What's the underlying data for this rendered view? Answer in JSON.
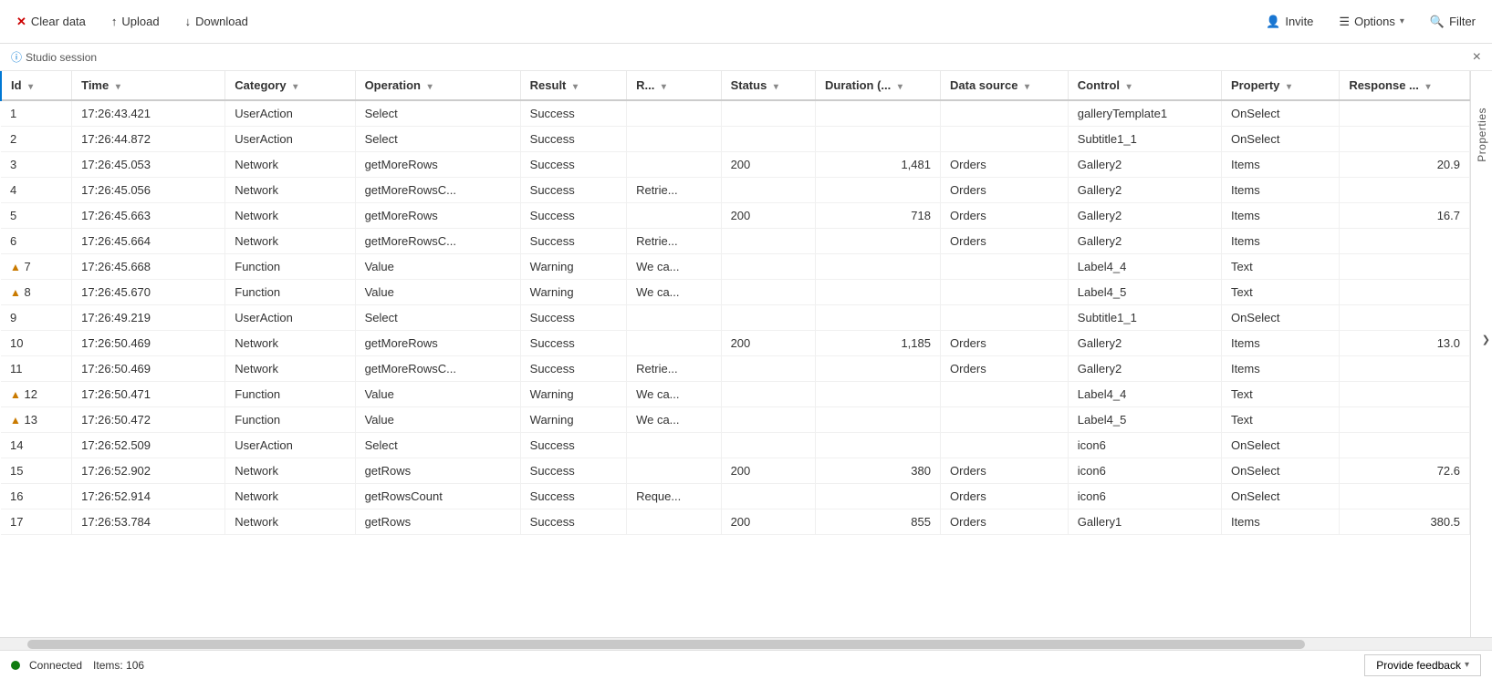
{
  "toolbar": {
    "clear_label": "Clear data",
    "upload_label": "Upload",
    "download_label": "Download",
    "invite_label": "Invite",
    "options_label": "Options",
    "filter_label": "Filter"
  },
  "session": {
    "label": "Studio session",
    "close_label": "×"
  },
  "side_panel": {
    "label": "Properties",
    "chevron": "❯"
  },
  "table": {
    "columns": [
      {
        "key": "id",
        "label": "Id",
        "sortable": true
      },
      {
        "key": "time",
        "label": "Time",
        "sortable": true
      },
      {
        "key": "category",
        "label": "Category",
        "sortable": true
      },
      {
        "key": "operation",
        "label": "Operation",
        "sortable": true
      },
      {
        "key": "result",
        "label": "Result",
        "sortable": true
      },
      {
        "key": "r",
        "label": "R...",
        "sortable": true
      },
      {
        "key": "status",
        "label": "Status",
        "sortable": true
      },
      {
        "key": "duration",
        "label": "Duration (...",
        "sortable": true
      },
      {
        "key": "datasource",
        "label": "Data source",
        "sortable": true
      },
      {
        "key": "control",
        "label": "Control",
        "sortable": true
      },
      {
        "key": "property",
        "label": "Property",
        "sortable": true
      },
      {
        "key": "response",
        "label": "Response ...",
        "sortable": true
      }
    ],
    "rows": [
      {
        "id": 1,
        "warning": false,
        "time": "17:26:43.421",
        "category": "UserAction",
        "operation": "Select",
        "result": "Success",
        "r": "",
        "status": "",
        "duration": "",
        "datasource": "",
        "control": "galleryTemplate1",
        "property": "OnSelect",
        "response": ""
      },
      {
        "id": 2,
        "warning": false,
        "time": "17:26:44.872",
        "category": "UserAction",
        "operation": "Select",
        "result": "Success",
        "r": "",
        "status": "",
        "duration": "",
        "datasource": "",
        "control": "Subtitle1_1",
        "property": "OnSelect",
        "response": ""
      },
      {
        "id": 3,
        "warning": false,
        "time": "17:26:45.053",
        "category": "Network",
        "operation": "getMoreRows",
        "result": "Success",
        "r": "",
        "status": "200",
        "duration": "1,481",
        "datasource": "Orders",
        "control": "Gallery2",
        "property": "Items",
        "response": "20.9"
      },
      {
        "id": 4,
        "warning": false,
        "time": "17:26:45.056",
        "category": "Network",
        "operation": "getMoreRowsC...",
        "result": "Success",
        "r": "Retrie...",
        "status": "",
        "duration": "",
        "datasource": "Orders",
        "control": "Gallery2",
        "property": "Items",
        "response": ""
      },
      {
        "id": 5,
        "warning": false,
        "time": "17:26:45.663",
        "category": "Network",
        "operation": "getMoreRows",
        "result": "Success",
        "r": "",
        "status": "200",
        "duration": "718",
        "datasource": "Orders",
        "control": "Gallery2",
        "property": "Items",
        "response": "16.7"
      },
      {
        "id": 6,
        "warning": false,
        "time": "17:26:45.664",
        "category": "Network",
        "operation": "getMoreRowsC...",
        "result": "Success",
        "r": "Retrie...",
        "status": "",
        "duration": "",
        "datasource": "Orders",
        "control": "Gallery2",
        "property": "Items",
        "response": ""
      },
      {
        "id": 7,
        "warning": true,
        "time": "17:26:45.668",
        "category": "Function",
        "operation": "Value",
        "result": "Warning",
        "r": "We ca...",
        "status": "",
        "duration": "",
        "datasource": "",
        "control": "Label4_4",
        "property": "Text",
        "response": ""
      },
      {
        "id": 8,
        "warning": true,
        "time": "17:26:45.670",
        "category": "Function",
        "operation": "Value",
        "result": "Warning",
        "r": "We ca...",
        "status": "",
        "duration": "",
        "datasource": "",
        "control": "Label4_5",
        "property": "Text",
        "response": ""
      },
      {
        "id": 9,
        "warning": false,
        "time": "17:26:49.219",
        "category": "UserAction",
        "operation": "Select",
        "result": "Success",
        "r": "",
        "status": "",
        "duration": "",
        "datasource": "",
        "control": "Subtitle1_1",
        "property": "OnSelect",
        "response": ""
      },
      {
        "id": 10,
        "warning": false,
        "time": "17:26:50.469",
        "category": "Network",
        "operation": "getMoreRows",
        "result": "Success",
        "r": "",
        "status": "200",
        "duration": "1,185",
        "datasource": "Orders",
        "control": "Gallery2",
        "property": "Items",
        "response": "13.0"
      },
      {
        "id": 11,
        "warning": false,
        "time": "17:26:50.469",
        "category": "Network",
        "operation": "getMoreRowsC...",
        "result": "Success",
        "r": "Retrie...",
        "status": "",
        "duration": "",
        "datasource": "Orders",
        "control": "Gallery2",
        "property": "Items",
        "response": ""
      },
      {
        "id": 12,
        "warning": true,
        "time": "17:26:50.471",
        "category": "Function",
        "operation": "Value",
        "result": "Warning",
        "r": "We ca...",
        "status": "",
        "duration": "",
        "datasource": "",
        "control": "Label4_4",
        "property": "Text",
        "response": ""
      },
      {
        "id": 13,
        "warning": true,
        "time": "17:26:50.472",
        "category": "Function",
        "operation": "Value",
        "result": "Warning",
        "r": "We ca...",
        "status": "",
        "duration": "",
        "datasource": "",
        "control": "Label4_5",
        "property": "Text",
        "response": ""
      },
      {
        "id": 14,
        "warning": false,
        "time": "17:26:52.509",
        "category": "UserAction",
        "operation": "Select",
        "result": "Success",
        "r": "",
        "status": "",
        "duration": "",
        "datasource": "",
        "control": "icon6",
        "property": "OnSelect",
        "response": ""
      },
      {
        "id": 15,
        "warning": false,
        "time": "17:26:52.902",
        "category": "Network",
        "operation": "getRows",
        "result": "Success",
        "r": "",
        "status": "200",
        "duration": "380",
        "datasource": "Orders",
        "control": "icon6",
        "property": "OnSelect",
        "response": "72.6"
      },
      {
        "id": 16,
        "warning": false,
        "time": "17:26:52.914",
        "category": "Network",
        "operation": "getRowsCount",
        "result": "Success",
        "r": "Reque...",
        "status": "",
        "duration": "",
        "datasource": "Orders",
        "control": "icon6",
        "property": "OnSelect",
        "response": ""
      },
      {
        "id": 17,
        "warning": false,
        "time": "17:26:53.784",
        "category": "Network",
        "operation": "getRows",
        "result": "Success",
        "r": "",
        "status": "200",
        "duration": "855",
        "datasource": "Orders",
        "control": "Gallery1",
        "property": "Items",
        "response": "380.5"
      }
    ]
  },
  "status": {
    "connected_label": "Connected",
    "items_label": "Items: 106"
  },
  "feedback": {
    "label": "Provide feedback",
    "chevron": "∨"
  }
}
